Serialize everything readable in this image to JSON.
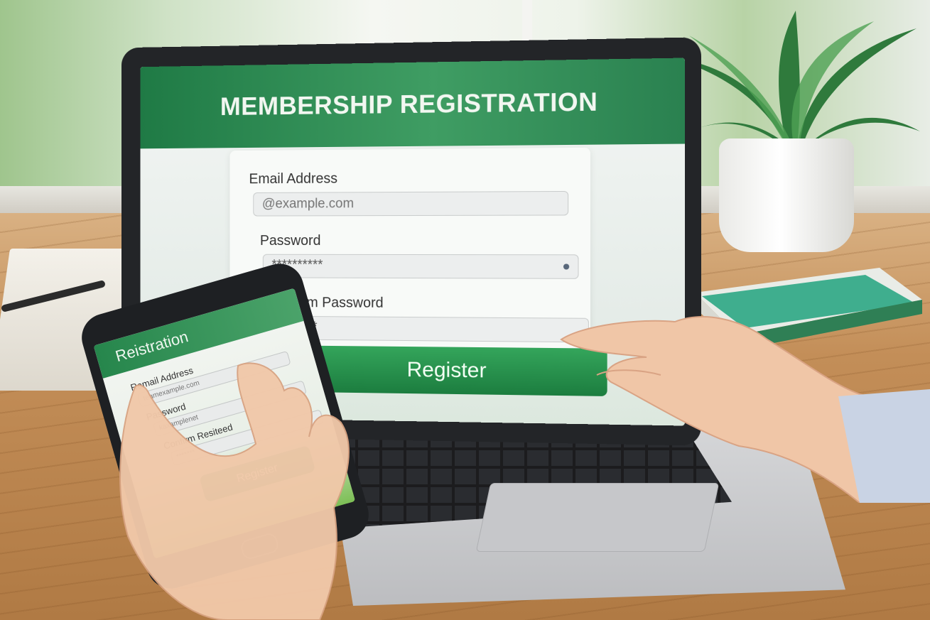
{
  "laptop_form": {
    "title": "MEMBERSHIP REGISTRATION",
    "email_label": "Email Address",
    "email_placeholder": "@example.com",
    "password_label": "Password",
    "password_value": "**********",
    "confirm_label": "Confirm Password",
    "confirm_value": "*******",
    "register_label": "Register"
  },
  "phone_form": {
    "title": "Reistration",
    "email_label": "Remail Address",
    "email_value": "teamexample.com",
    "password_label": "Password",
    "password_value": "kaxamplenet",
    "confirm_label": "Confirm Resiteed",
    "confirm_value": "*******",
    "register_label": "Register"
  },
  "colors": {
    "brand_green": "#2a8150",
    "button_green": "#1c7d3f"
  },
  "icons": [
    "password-status-dot-icon",
    "horseshoe-icon",
    "plant-icon",
    "phone-home-icon"
  ]
}
